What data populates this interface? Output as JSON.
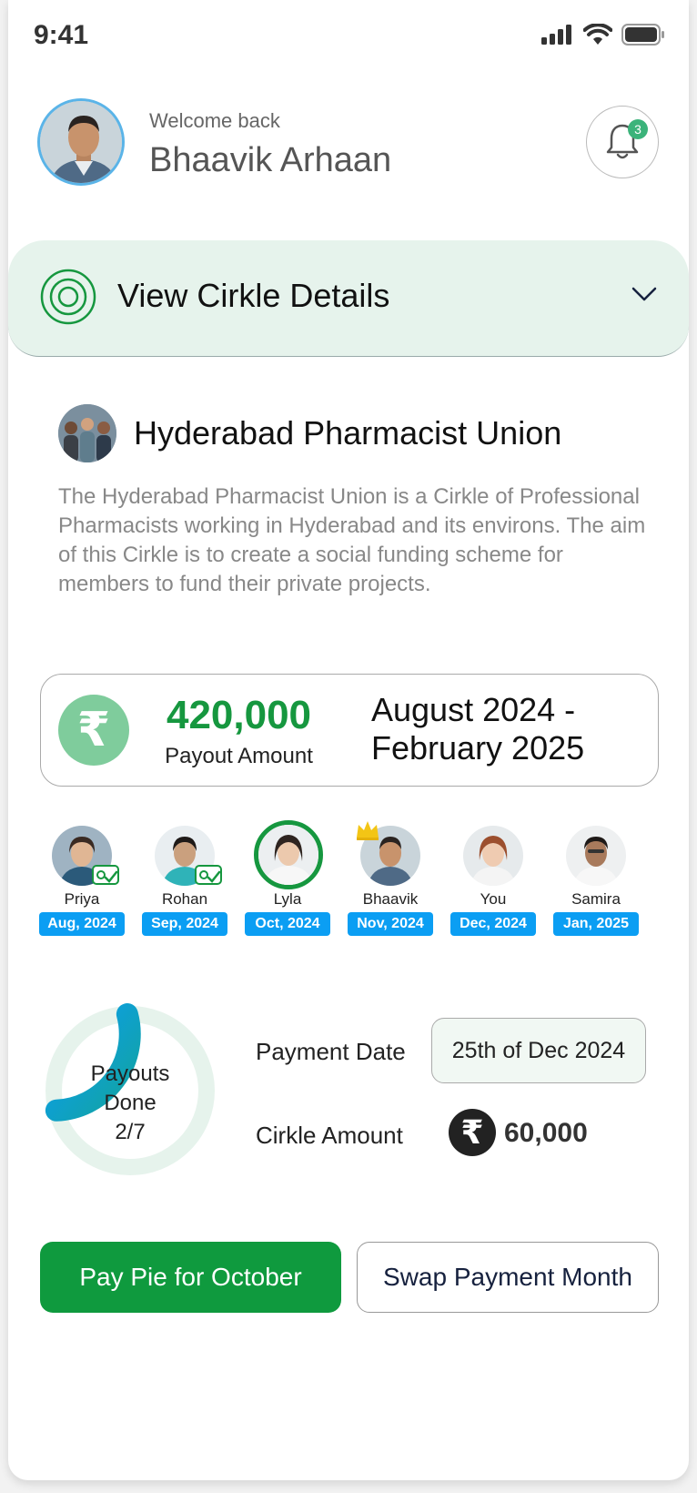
{
  "status_bar": {
    "time": "9:41"
  },
  "header": {
    "welcome": "Welcome back",
    "user_name": "Bhaavik Arhaan",
    "notification_count": "3"
  },
  "cirkle_bar": {
    "title": "View Cirkle Details"
  },
  "group": {
    "name": "Hyderabad Pharmacist Union",
    "description": "The Hyderabad Pharmacist Union is a Cirkle of Professional Pharmacists working in Hyderabad and its environs. The aim of this Cirkle is to create a social funding scheme for members to fund their private projects."
  },
  "payout": {
    "currency_symbol": "₹",
    "amount": "420,000",
    "label": "Payout Amount",
    "period_line1": "August 2024 -",
    "period_line2": "February 2025"
  },
  "members": [
    {
      "name": "Priya",
      "month": "Aug, 2024",
      "paid": true
    },
    {
      "name": "Rohan",
      "month": "Sep, 2024",
      "paid": true
    },
    {
      "name": "Lyla",
      "month": "Oct, 2024",
      "active": true
    },
    {
      "name": "Bhaavik",
      "month": "Nov, 2024",
      "crown": true
    },
    {
      "name": "You",
      "month": "Dec, 2024"
    },
    {
      "name": "Samira",
      "month": "Jan, 2025"
    }
  ],
  "payouts_progress": {
    "line1": "Payouts",
    "line2": "Done",
    "line3": "2/7",
    "done": 2,
    "total": 7
  },
  "payment": {
    "date_label": "Payment Date",
    "date_value": "25th of Dec 2024",
    "amount_label": "Cirkle Amount",
    "currency_symbol": "₹",
    "amount_value": "60,000"
  },
  "actions": {
    "pay_label": "Pay Pie for October",
    "swap_label": "Swap Payment Month"
  },
  "colors": {
    "brand_green": "#0f9a3e",
    "month_badge": "#0b9ef3",
    "progress_start": "#0b9ef3",
    "progress_end": "#12a3a0",
    "bar_bg": "#e6f3ec"
  }
}
